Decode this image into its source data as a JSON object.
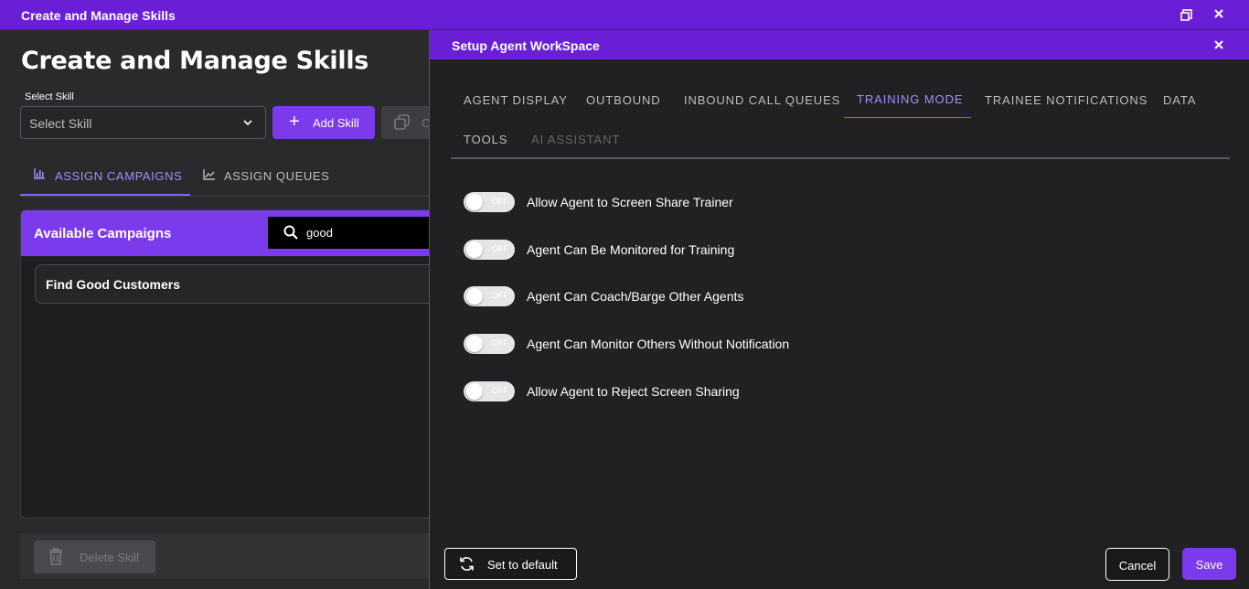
{
  "window": {
    "title": "Create and Manage Skills"
  },
  "background": {
    "heading": "Create and Manage Skills",
    "select_skill_label": "Select Skill",
    "select_skill_value": "Select Skill",
    "add_skill_label": "Add Skill",
    "copy_label": "C",
    "tabs": [
      {
        "label": "ASSIGN CAMPAIGNS",
        "active": true
      },
      {
        "label": "ASSIGN QUEUES",
        "active": false
      }
    ],
    "campaigns": {
      "header": "Available Campaigns",
      "search_value": "good",
      "items": [
        "Find Good Customers"
      ]
    },
    "delete_label": "Delete Skill"
  },
  "modal": {
    "title": "Setup Agent WorkSpace",
    "tabs": [
      {
        "label": "AGENT DISPLAY",
        "state": "normal"
      },
      {
        "label": "OUTBOUND",
        "state": "normal"
      },
      {
        "label": "INBOUND CALL QUEUES",
        "state": "normal"
      },
      {
        "label": "TRAINING MODE",
        "state": "active"
      },
      {
        "label": "TRAINEE NOTIFICATIONS",
        "state": "normal"
      },
      {
        "label": "DATA",
        "state": "normal"
      },
      {
        "label": "TOOLS",
        "state": "normal"
      },
      {
        "label": "AI ASSISTANT",
        "state": "disabled"
      }
    ],
    "toggles": [
      {
        "label": "Allow Agent to Screen Share Trainer",
        "state": "OFF"
      },
      {
        "label": "Agent Can Be Monitored for Training",
        "state": "OFF"
      },
      {
        "label": "Agent Can Coach/Barge Other Agents",
        "state": "OFF"
      },
      {
        "label": "Agent Can Monitor Others Without Notification",
        "state": "OFF"
      },
      {
        "label": "Allow Agent to Reject Screen Sharing",
        "state": "OFF"
      }
    ],
    "set_default_label": "Set to default",
    "cancel_label": "Cancel",
    "save_label": "Save"
  },
  "colors": {
    "accent": "#7c3aed",
    "titlebar": "#6a1fd6",
    "active_tab": "#a78bfa"
  },
  "icons": [
    "restore-icon",
    "close-icon",
    "chevron-down-icon",
    "plus-icon",
    "copy-icon",
    "bar-chart-icon",
    "line-chart-icon",
    "search-icon",
    "trash-icon",
    "refresh-icon"
  ]
}
